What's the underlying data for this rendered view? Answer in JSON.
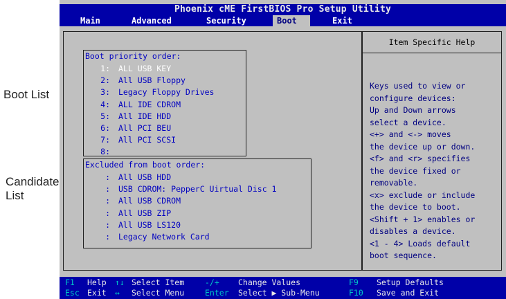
{
  "title": "Phoenix cME FirstBIOS Pro Setup Utility",
  "menu": [
    "Main",
    "Advanced",
    "Security",
    "Boot",
    "Exit"
  ],
  "menu_active": "Boot",
  "boot_priority": {
    "title": "Boot priority order:",
    "items": [
      {
        "index": "1:",
        "name": "ALL USB KEY",
        "selected": true
      },
      {
        "index": "2:",
        "name": "All USB Floppy"
      },
      {
        "index": "3:",
        "name": "Legacy Floppy Drives"
      },
      {
        "index": "4:",
        "name": "ALL IDE CDROM"
      },
      {
        "index": "5:",
        "name": "All IDE HDD"
      },
      {
        "index": "6:",
        "name": "All PCI BEU"
      },
      {
        "index": "7:",
        "name": "All PCI SCSI"
      },
      {
        "index": "8:",
        "name": ""
      }
    ]
  },
  "excluded": {
    "title": "Excluded from boot order:",
    "items": [
      {
        "index": ":",
        "name": "All USB HDD"
      },
      {
        "index": ":",
        "name": "USB CDROM: PepperC Uirtual Disc 1"
      },
      {
        "index": ":",
        "name": "All USB CDROM"
      },
      {
        "index": ":",
        "name": "All USB ZIP"
      },
      {
        "index": ":",
        "name": "All USB LS120"
      },
      {
        "index": ":",
        "name": "Legacy Network Card"
      }
    ]
  },
  "help": {
    "title": "Item Specific Help",
    "text": "Keys used to view or\nconfigure devices:\nUp and Down arrows\nselect a device.\n<+> and <-> moves\nthe device up or down.\n<f> and <r> specifies\nthe device fixed or\nremovable.\n<x> exclude or include\nthe device to boot.\n<Shift + 1> enables or\ndisables a device.\n<1 - 4> Loads default\nboot sequence."
  },
  "status": {
    "f1_key": "F1",
    "f1_label": "Help",
    "updown_key": "↑↓",
    "select_item": "Select Item",
    "plusminus_key": "-/+",
    "change_values": "Change Values",
    "f9_key": "F9",
    "setup_defaults": "Setup Defaults",
    "esc_key": "Esc",
    "exit_label": "Exit",
    "leftright_key": "↔",
    "select_menu": "Select Menu",
    "enter_key": "Enter",
    "select_submenu": "Select ▶ Sub-Menu",
    "f10_key": "F10",
    "save_exit": "Save and Exit"
  },
  "annotations": {
    "boot_list": "Boot List",
    "candidate_line1": "Candidate",
    "candidate_line2": "List"
  }
}
